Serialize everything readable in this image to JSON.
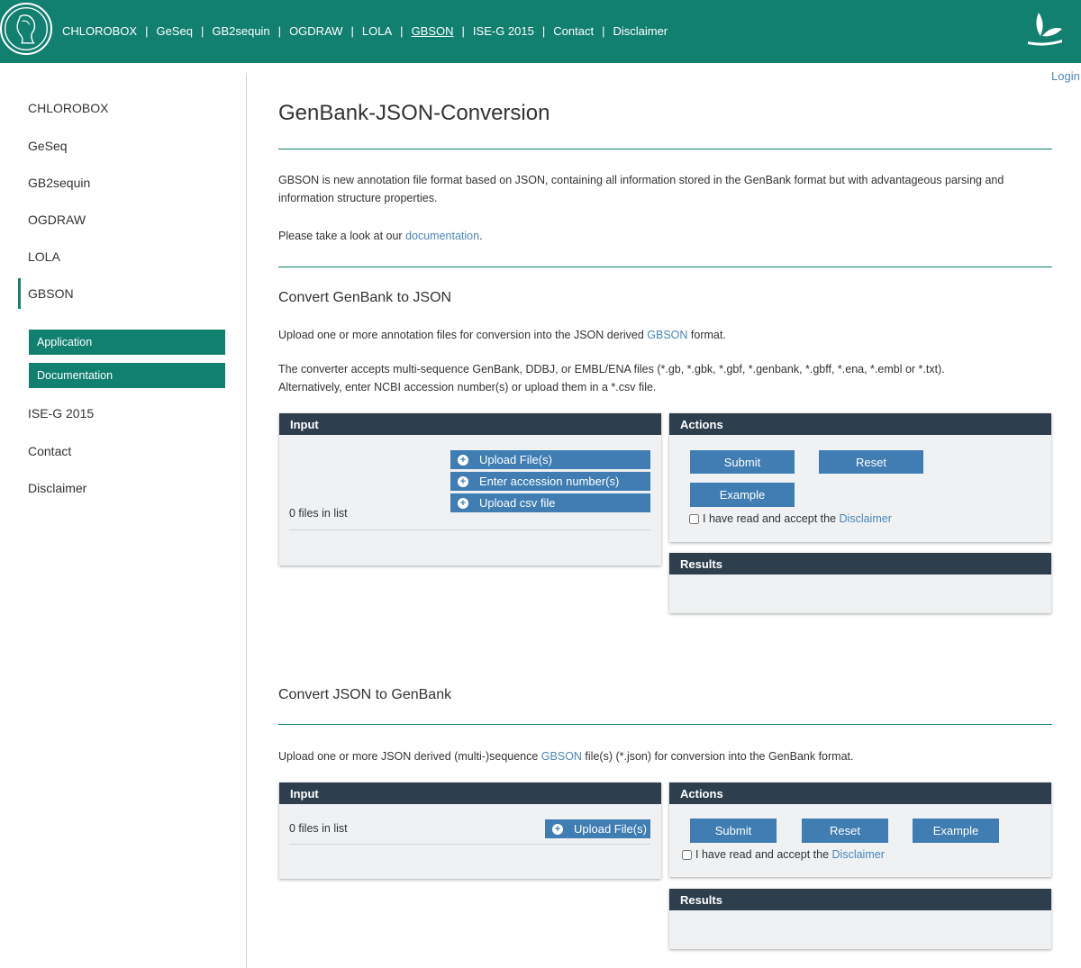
{
  "header": {
    "nav": [
      "CHLOROBOX",
      "GeSeq",
      "GB2sequin",
      "OGDRAW",
      "LOLA",
      "GBSON",
      "ISE-G 2015",
      "Contact",
      "Disclaimer"
    ],
    "active": "GBSON",
    "separator": "|",
    "brand_color": "#12806f"
  },
  "login": "Login",
  "sidebar": {
    "items": [
      "CHLOROBOX",
      "GeSeq",
      "GB2sequin",
      "OGDRAW",
      "LOLA",
      "GBSON"
    ],
    "sub_items": [
      "Application",
      "Documentation"
    ],
    "items_after": [
      "ISE-G 2015",
      "Contact",
      "Disclaimer"
    ]
  },
  "main": {
    "title": "GenBank-JSON-Conversion",
    "intro": "GBSON is new annotation file format based on JSON, containing all information stored in the GenBank format but with advantageous parsing and information structure properties.",
    "doc_prefix": "Please take a look at our ",
    "doc_link": "documentation",
    "doc_suffix": "."
  },
  "section1": {
    "title": "Convert GenBank to JSON",
    "upload_prefix": "Upload one or more annotation files for conversion into the JSON derived ",
    "upload_link": "GBSON",
    "upload_suffix": " format.",
    "accepts_line1": "The converter accepts multi-sequence GenBank, DDBJ, or EMBL/ENA files (*.gb, *.gbk, *.gbf, *.genbank, *.gbff, *.ena, *.embl or *.txt).",
    "accepts_line2": "Alternatively, enter NCBI accession number(s) or upload them in a *.csv file.",
    "input_title": "Input",
    "upload_files": "Upload File(s)",
    "enter_accession": "Enter accession number(s)",
    "upload_csv": "Upload csv file",
    "files_count": "0 files in list",
    "actions_title": "Actions",
    "submit": "Submit",
    "reset": "Reset",
    "example": "Example",
    "accept_prefix": "I have read and accept the ",
    "accept_link": "Disclaimer",
    "results_title": "Results"
  },
  "section2": {
    "title": "Convert JSON to GenBank",
    "upload_prefix": "Upload one or more JSON derived (multi-)sequence ",
    "upload_link": "GBSON",
    "upload_suffix": " file(s) (*.json) for conversion into the GenBank format.",
    "input_title": "Input",
    "files_count": "0 files in list",
    "upload_files": "Upload File(s)",
    "actions_title": "Actions",
    "submit": "Submit",
    "reset": "Reset",
    "example": "Example",
    "accept_prefix": "I have read and accept the ",
    "accept_link": "Disclaimer",
    "results_title": "Results"
  }
}
